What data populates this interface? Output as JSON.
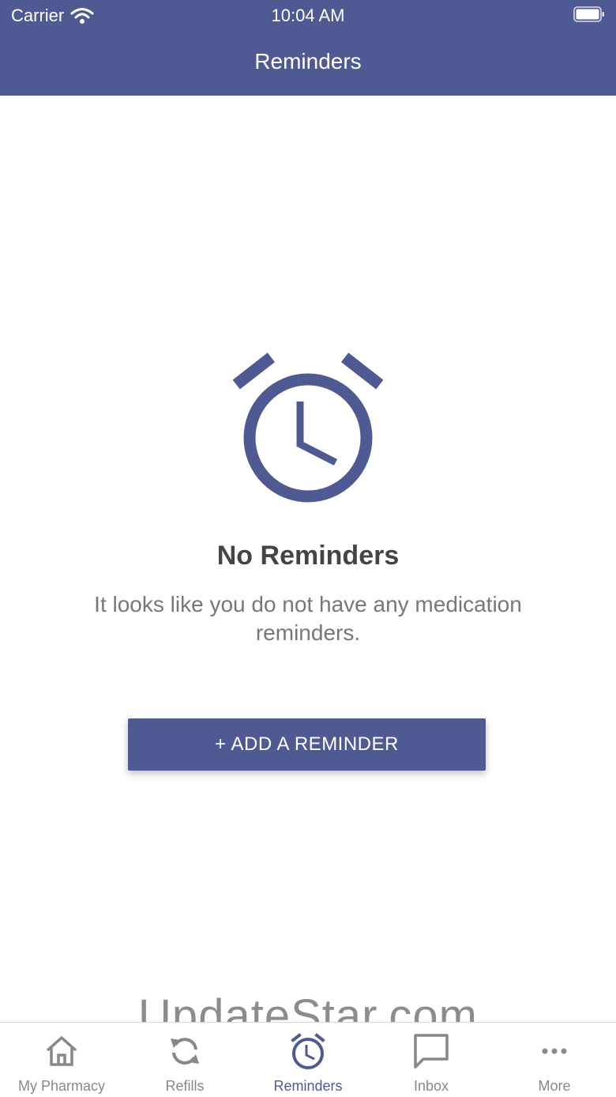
{
  "status_bar": {
    "carrier": "Carrier",
    "time": "10:04 AM"
  },
  "header": {
    "title": "Reminders"
  },
  "empty_state": {
    "icon": "alarm-clock-icon",
    "title": "No Reminders",
    "message": "It looks like you do not have any medication reminders."
  },
  "add_button": {
    "label": "+ ADD A REMINDER"
  },
  "watermark": "UpdateStar.com",
  "tab_bar": {
    "active_index": 2,
    "items": [
      {
        "label": "My Pharmacy",
        "icon": "home-icon"
      },
      {
        "label": "Refills",
        "icon": "refresh-icon"
      },
      {
        "label": "Reminders",
        "icon": "alarm-clock-icon"
      },
      {
        "label": "Inbox",
        "icon": "chat-bubble-icon"
      },
      {
        "label": "More",
        "icon": "more-dots-icon"
      }
    ]
  },
  "colors": {
    "primary": "#505a92",
    "inactive_tab": "#888888",
    "title_text": "#444444",
    "body_text": "#777777"
  }
}
